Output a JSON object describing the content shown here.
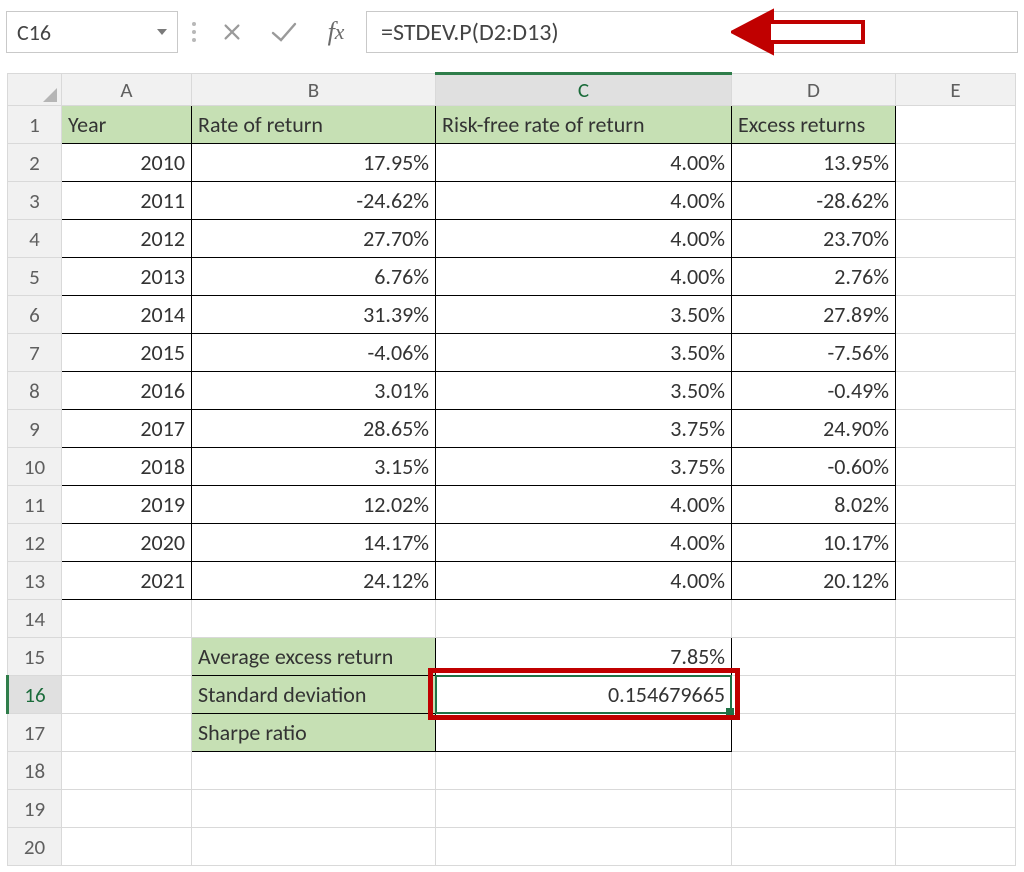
{
  "formula_bar": {
    "name_box": "C16",
    "formula": "=STDEV.P(D2:D13)"
  },
  "columns": [
    "A",
    "B",
    "C",
    "D",
    "E"
  ],
  "active_col_index": 2,
  "active_row": 16,
  "row_count": 20,
  "headers": {
    "A": "Year",
    "B": "Rate of return",
    "C": "Risk-free rate of return",
    "D": "Excess returns"
  },
  "data_rows": [
    {
      "row": 2,
      "A": "2010",
      "B": "17.95%",
      "C": "4.00%",
      "D": "13.95%"
    },
    {
      "row": 3,
      "A": "2011",
      "B": "-24.62%",
      "C": "4.00%",
      "D": "-28.62%"
    },
    {
      "row": 4,
      "A": "2012",
      "B": "27.70%",
      "C": "4.00%",
      "D": "23.70%"
    },
    {
      "row": 5,
      "A": "2013",
      "B": "6.76%",
      "C": "4.00%",
      "D": "2.76%"
    },
    {
      "row": 6,
      "A": "2014",
      "B": "31.39%",
      "C": "3.50%",
      "D": "27.89%"
    },
    {
      "row": 7,
      "A": "2015",
      "B": "-4.06%",
      "C": "3.50%",
      "D": "-7.56%"
    },
    {
      "row": 8,
      "A": "2016",
      "B": "3.01%",
      "C": "3.50%",
      "D": "-0.49%"
    },
    {
      "row": 9,
      "A": "2017",
      "B": "28.65%",
      "C": "3.75%",
      "D": "24.90%"
    },
    {
      "row": 10,
      "A": "2018",
      "B": "3.15%",
      "C": "3.75%",
      "D": "-0.60%"
    },
    {
      "row": 11,
      "A": "2019",
      "B": "12.02%",
      "C": "4.00%",
      "D": "8.02%"
    },
    {
      "row": 12,
      "A": "2020",
      "B": "14.17%",
      "C": "4.00%",
      "D": "10.17%"
    },
    {
      "row": 13,
      "A": "2021",
      "B": "24.12%",
      "C": "4.00%",
      "D": "20.12%"
    }
  ],
  "summary": {
    "avg_label": "Average excess return",
    "avg_value": "7.85%",
    "std_label": "Standard deviation",
    "std_value": "0.154679665",
    "sharpe_label": "Sharpe ratio",
    "sharpe_value": ""
  },
  "highlight": {
    "red_box_cell": "C16",
    "arrow_target": "formula_bar"
  },
  "colors": {
    "header_fill": "#c6e0b4",
    "selection": "#1f7246",
    "callout": "#c00000"
  }
}
